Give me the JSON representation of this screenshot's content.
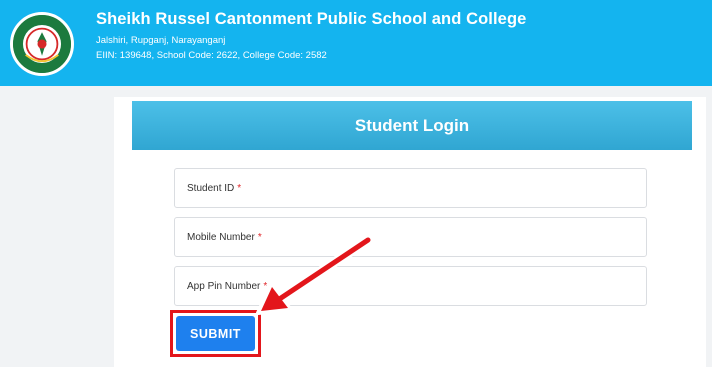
{
  "header": {
    "school_name": "Sheikh Russel Cantonment Public School and College",
    "address": "Jalshiri, Rupganj, Narayanganj",
    "codes": "EIIN: 139648, School Code: 2622, College Code: 2582",
    "background_color": "#14b4ef",
    "logo_icon": "school-crest-icon"
  },
  "login": {
    "title": "Student Login",
    "fields": [
      {
        "label": "Student ID",
        "required_mark": "*"
      },
      {
        "label": "Mobile Number",
        "required_mark": "*"
      },
      {
        "label": "App Pin Number",
        "required_mark": "*"
      }
    ],
    "submit_label": "SUBMIT",
    "submit_color": "#1e80ee"
  },
  "annotation": {
    "highlight_color": "#e3161b",
    "arrow_icon": "red-arrow-pointer-icon"
  }
}
